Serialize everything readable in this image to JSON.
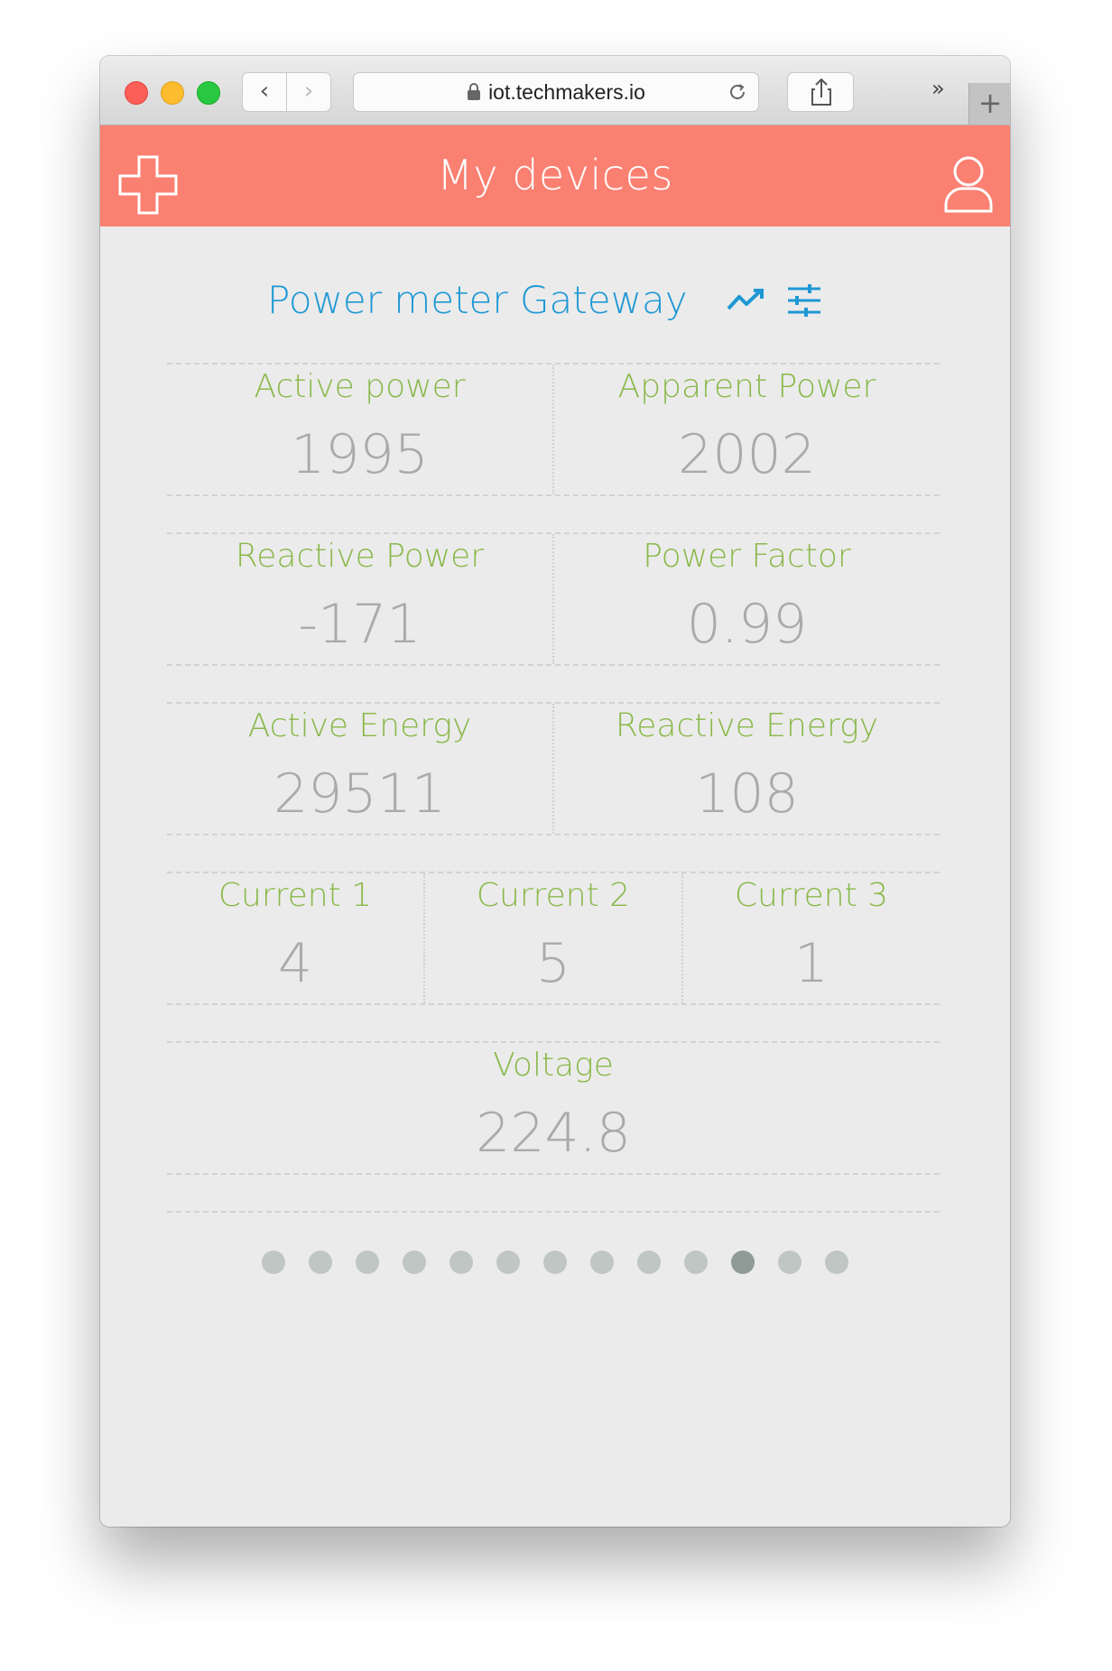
{
  "browser": {
    "url": "iot.techmakers.io",
    "back_label": "‹",
    "forward_label": "›",
    "more_label": "»",
    "new_tab_label": "+"
  },
  "appbar": {
    "title": "My devices",
    "add_icon": "plus-outline-icon",
    "profile_icon": "user-outline-icon",
    "color": "#fa8072"
  },
  "device": {
    "name": "Power meter Gateway",
    "chart_icon": "trend-line-icon",
    "settings_icon": "sliders-icon",
    "name_color": "#1e98d4"
  },
  "metrics": {
    "active_power": {
      "label": "Active power",
      "value": "1995"
    },
    "apparent_power": {
      "label": "Apparent Power",
      "value": "2002"
    },
    "reactive_power": {
      "label": "Reactive Power",
      "value": "-171"
    },
    "power_factor": {
      "label": "Power Factor",
      "value": "0.99"
    },
    "active_energy": {
      "label": "Active Energy",
      "value": "29511"
    },
    "reactive_energy": {
      "label": "Reactive Energy",
      "value": "108"
    },
    "current_1": {
      "label": "Current 1",
      "value": "4"
    },
    "current_2": {
      "label": "Current 2",
      "value": "5"
    },
    "current_3": {
      "label": "Current 3",
      "value": "1"
    },
    "voltage": {
      "label": "Voltage",
      "value": "224.8"
    }
  },
  "colors": {
    "label": "#8ab84a",
    "value": "#aaaaaa",
    "dot": "#bfc6c3",
    "dot_active": "#8e9b96"
  },
  "pagination": {
    "total": 13,
    "active_index": 10
  }
}
